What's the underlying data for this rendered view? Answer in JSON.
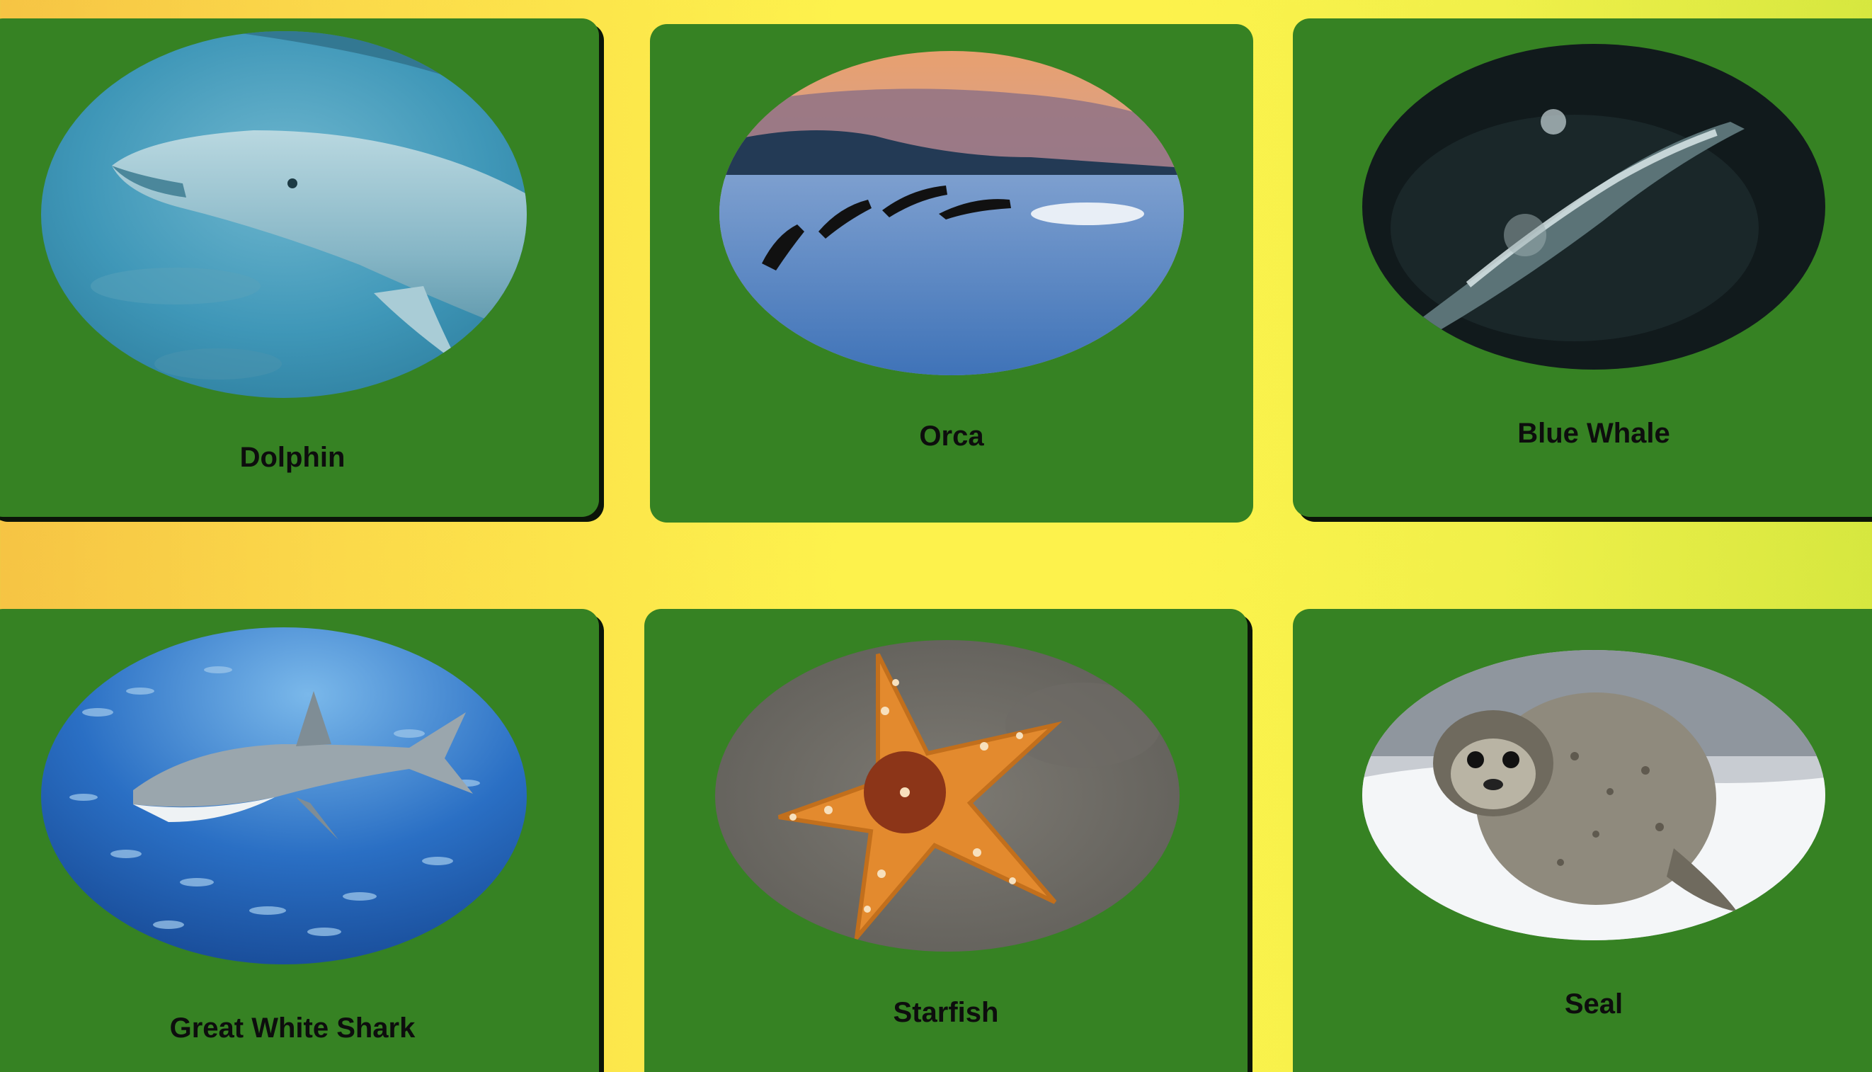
{
  "cards": [
    {
      "label": "Dolphin",
      "image": "dolphin-photo"
    },
    {
      "label": "Orca",
      "image": "orca-photo"
    },
    {
      "label": "Blue Whale",
      "image": "blue-whale-photo"
    },
    {
      "label": "Great White Shark",
      "image": "great-white-shark-photo"
    },
    {
      "label": "Starfish",
      "image": "starfish-photo"
    },
    {
      "label": "Seal",
      "image": "seal-photo"
    }
  ],
  "colors": {
    "card_background": "#368223",
    "page_gradient_left": "#f6c444",
    "page_gradient_mid": "#fdf24c",
    "page_gradient_right": "#d6e73f",
    "label_text": "#0d0d0d"
  }
}
